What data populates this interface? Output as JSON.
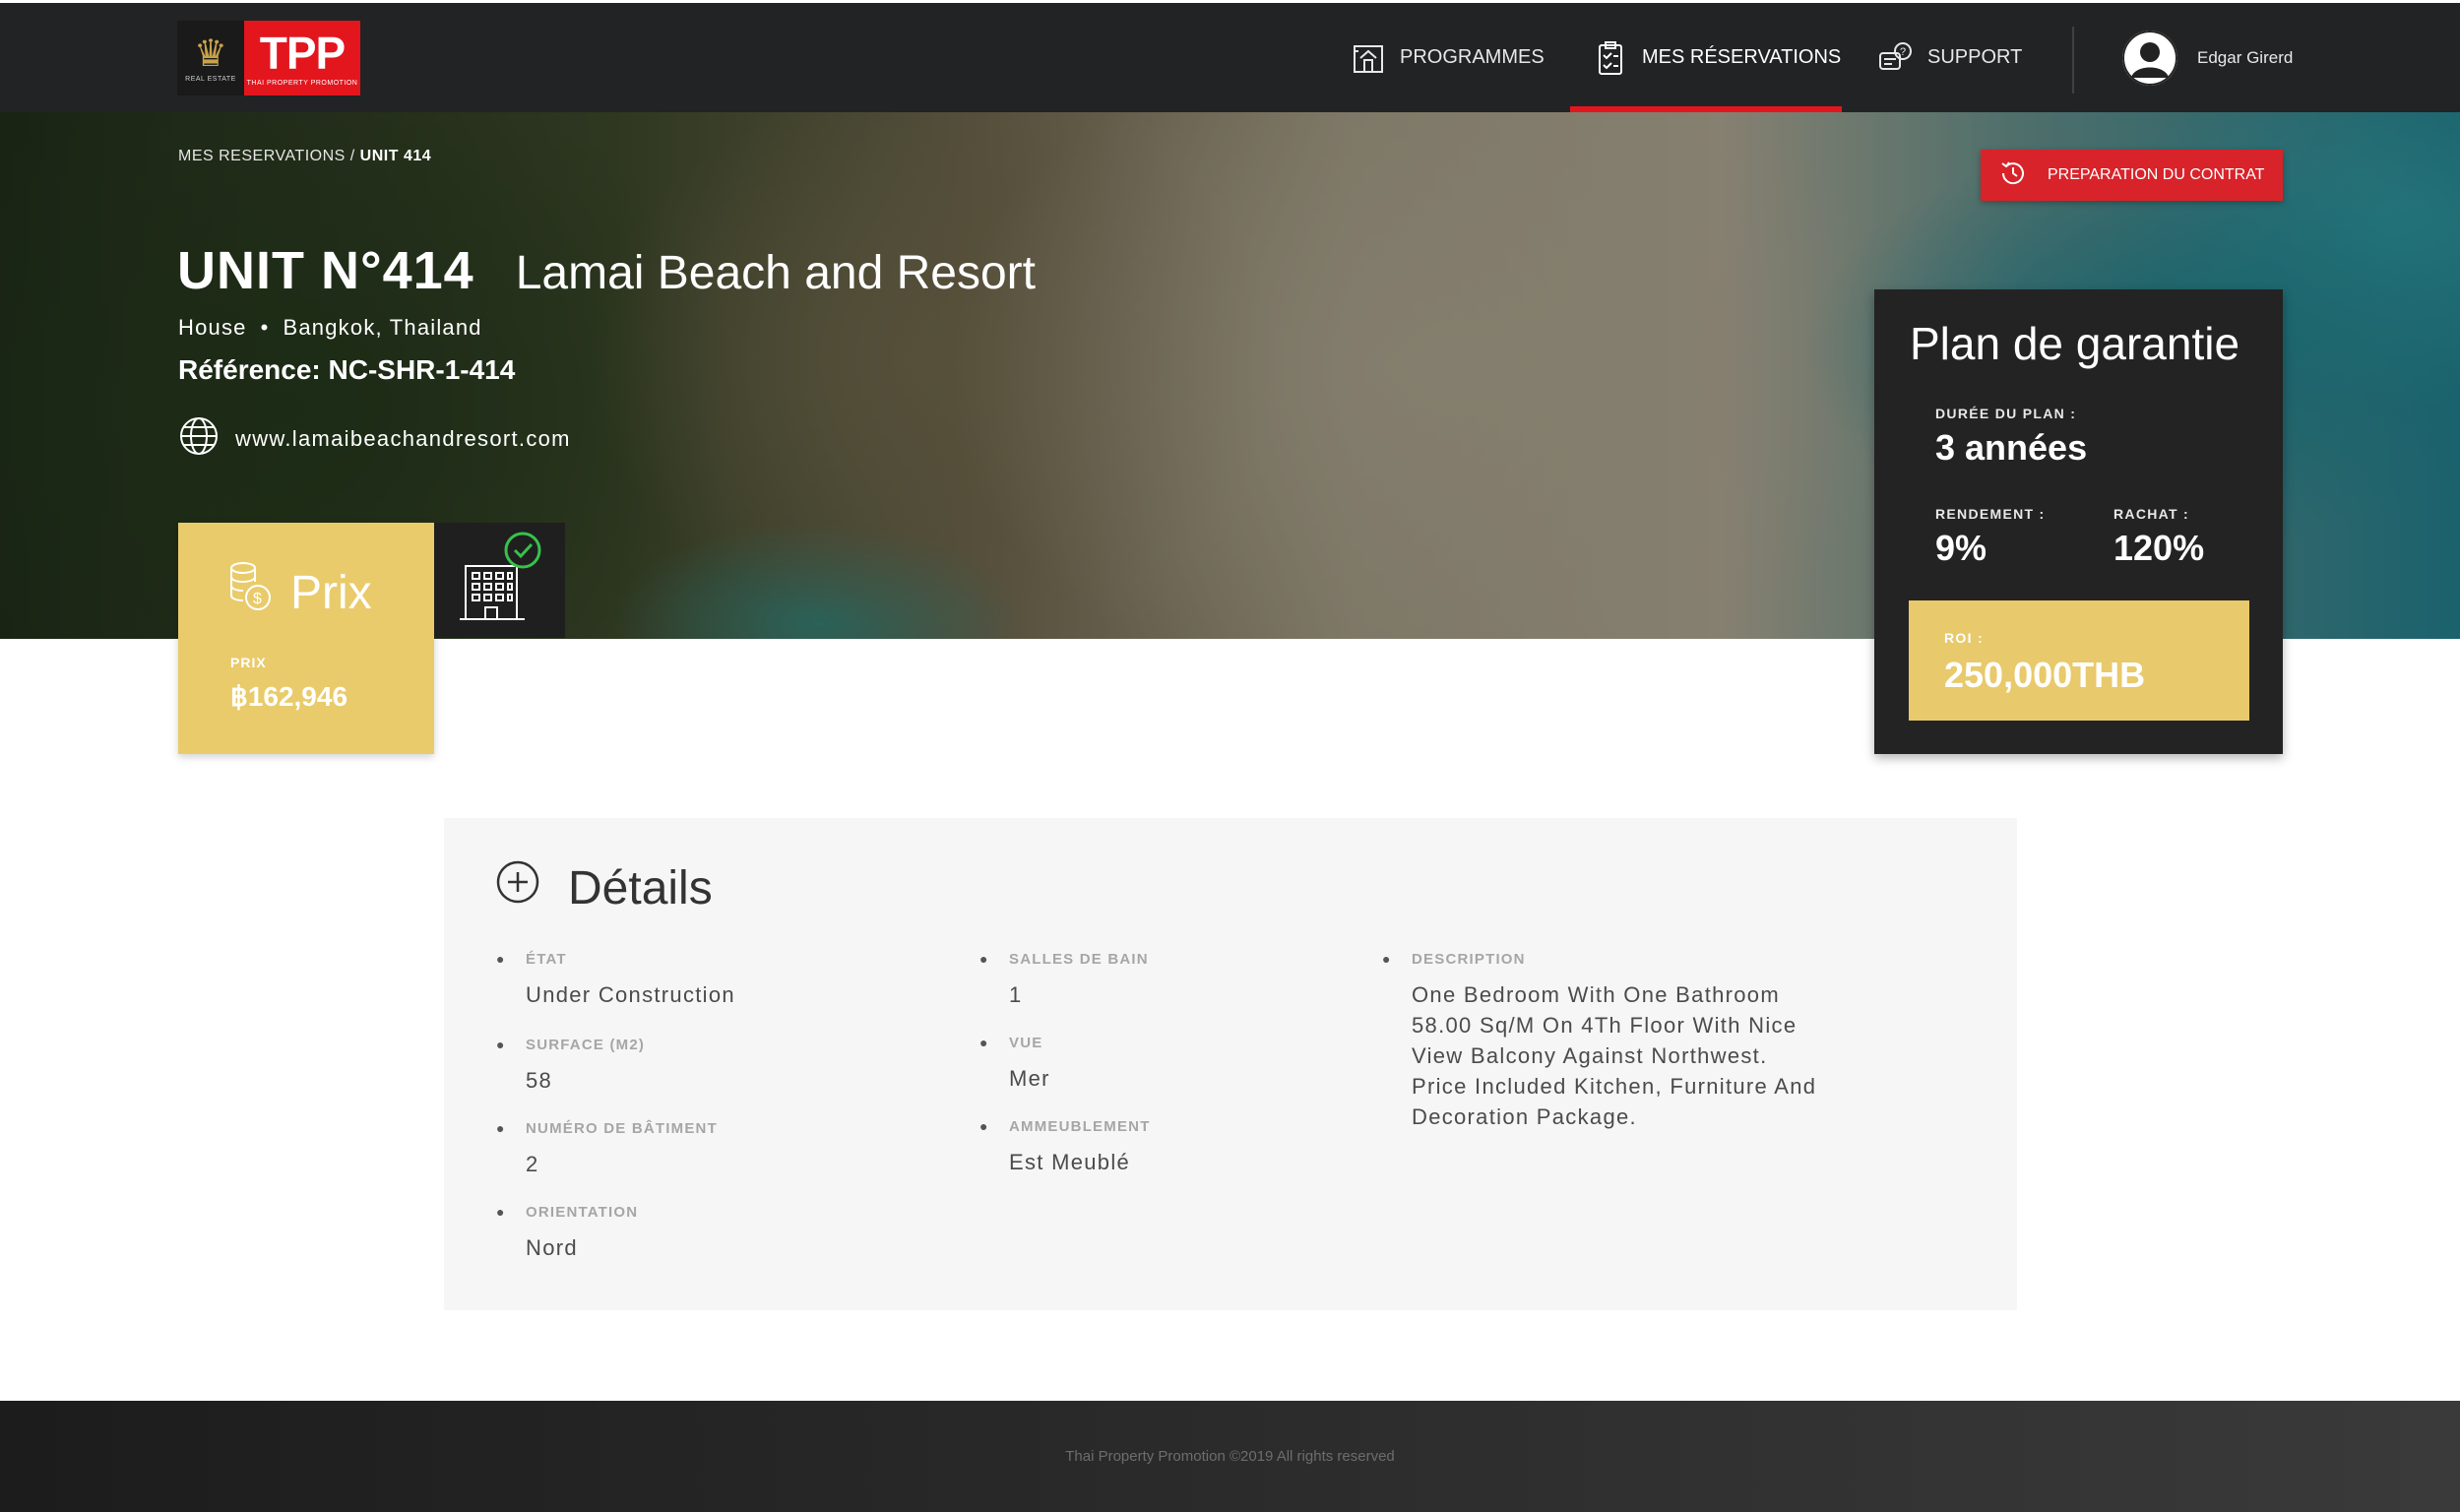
{
  "brand": {
    "logo_small": "REAL ESTATE",
    "logo_text": "TPP",
    "logo_sub": "THAI PROPERTY PROMOTION"
  },
  "nav": {
    "programmes": "PROGRAMMES",
    "reservations": "MES RÉSERVATIONS",
    "support": "SUPPORT",
    "active": "reservations"
  },
  "user": {
    "name": "Edgar Girerd"
  },
  "breadcrumb": {
    "parent": "MES RESERVATIONS",
    "separator": "/",
    "current": "UNIT 414"
  },
  "contract_button": "PREPARATION DU CONTRAT",
  "unit": {
    "title": "UNIT N°414",
    "project": "Lamai Beach and Resort",
    "type": "House",
    "separator": "•",
    "location": "Bangkok, Thailand",
    "reference": "Référence: NC-SHR-1-414",
    "website": "www.lamaibeachandresort.com"
  },
  "price": {
    "heading": "Prix",
    "label": "PRIX",
    "value": "฿162,946"
  },
  "plan": {
    "title": "Plan de garantie",
    "duration_label": "DURÉE DU PLAN :",
    "duration_value": "3 années",
    "yield_label": "RENDEMENT :",
    "yield_value": "9%",
    "buyback_label": "RACHAT :",
    "buyback_value": "120%",
    "roi_label": "ROI :",
    "roi_value": "250,000THB"
  },
  "details": {
    "title": "Détails",
    "etat_label": "ÉTAT",
    "etat_value": "Under Construction",
    "surface_label": "SURFACE (M2)",
    "surface_value": "58",
    "batiment_label": "NUMÉRO DE BÂTIMENT",
    "batiment_value": "2",
    "orientation_label": "ORIENTATION",
    "orientation_value": "Nord",
    "bain_label": "SALLES DE BAIN",
    "bain_value": "1",
    "vue_label": "VUE",
    "vue_value": "Mer",
    "ameub_label": "AMMEUBLEMENT",
    "ameub_value": "Est Meublé",
    "desc_label": "DESCRIPTION",
    "desc_value": "One Bedroom With One Bathroom 58.00 Sq/M On 4Th Floor With Nice View Balcony Against Northwest. Price Included Kitchen, Furniture And Decoration Package."
  },
  "footer": {
    "copyright": "Thai Property Promotion ©2019  All rights reserved"
  },
  "colors": {
    "accent_red": "#e3161e",
    "gold": "#e9cb6b",
    "dark": "#222324"
  }
}
